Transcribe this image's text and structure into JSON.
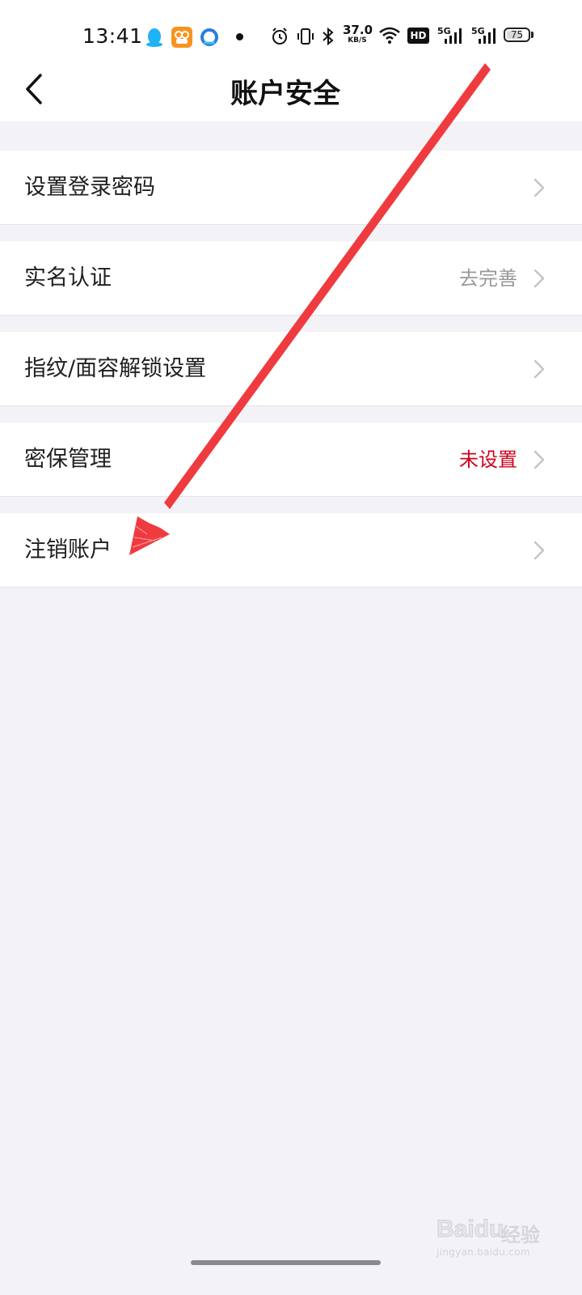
{
  "status_bar": {
    "time": "13:41",
    "net_speed_value": "37.0",
    "net_speed_unit": "KB/S",
    "hd_badge": "HD",
    "signal_1": "5G",
    "signal_2": "5G",
    "battery_level": "75"
  },
  "header": {
    "title": "账户安全",
    "back_icon": "chevron-left-icon"
  },
  "rows": [
    {
      "label": "设置登录密码",
      "value": "",
      "value_color": "#999999"
    },
    {
      "label": "实名认证",
      "value": "去完善",
      "value_color": "#999999"
    },
    {
      "label": "指纹/面容解锁设置",
      "value": "",
      "value_color": "#999999"
    },
    {
      "label": "密保管理",
      "value": "未设置",
      "value_color": "#d0021b"
    },
    {
      "label": "注销账户",
      "value": "",
      "value_color": "#999999"
    }
  ],
  "colors": {
    "arrow": "#ef3b3f",
    "background": "#f3f3f7",
    "card": "#ffffff",
    "chevron": "#c4c4c8"
  },
  "watermark": {
    "brand": "Baidu",
    "service": "经验",
    "url": "jingyan.baidu.com"
  }
}
